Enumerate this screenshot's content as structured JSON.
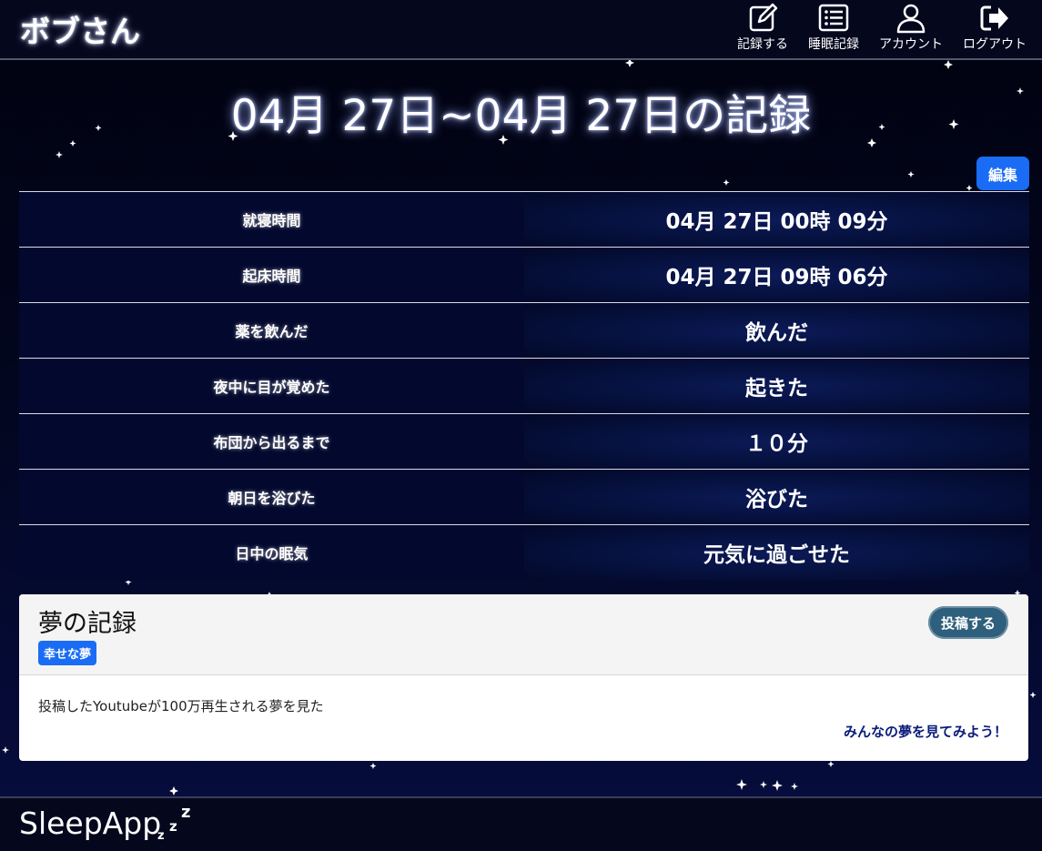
{
  "header": {
    "user_name": "ボブさん",
    "nav": [
      {
        "label": "記録する",
        "icon": "pencil-square-icon"
      },
      {
        "label": "睡眠記録",
        "icon": "list-icon"
      },
      {
        "label": "アカウント",
        "icon": "person-icon"
      },
      {
        "label": "ログアウト",
        "icon": "logout-icon"
      }
    ]
  },
  "main": {
    "title": "04月 27日~04月 27日の記録",
    "edit_label": "編集",
    "records": [
      {
        "label": "就寝時間",
        "value": "04月 27日 00時 09分"
      },
      {
        "label": "起床時間",
        "value": "04月 27日 09時 06分"
      },
      {
        "label": "薬を飲んだ",
        "value": "飲んだ"
      },
      {
        "label": "夜中に目が覚めた",
        "value": "起きた"
      },
      {
        "label": "布団から出るまで",
        "value": "１０分"
      },
      {
        "label": "朝日を浴びた",
        "value": "浴びた"
      },
      {
        "label": "日中の眠気",
        "value": "元気に過ごせた"
      }
    ]
  },
  "dream": {
    "title": "夢の記録",
    "tag": "幸せな夢",
    "post_label": "投稿する",
    "body": "投稿したYoutubeが100万再生される夢を見た",
    "link": "みんなの夢を見てみよう！"
  },
  "footer": {
    "logo": "SleepApp",
    "logo_z": "z"
  },
  "colors": {
    "accent": "#1a6cf5",
    "post_button": "#2e5f7c",
    "link": "#0a1c7a",
    "background": "#02061e"
  }
}
